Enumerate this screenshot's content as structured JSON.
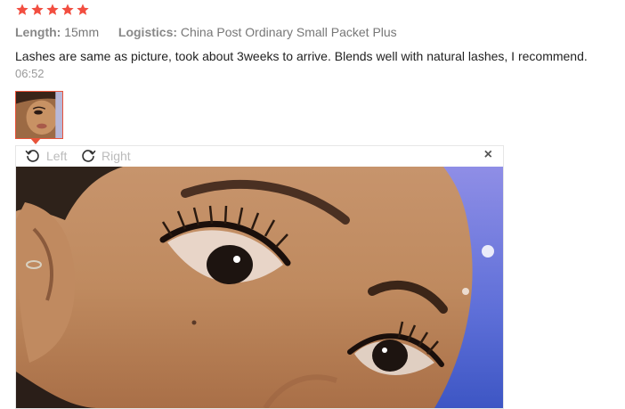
{
  "rating": {
    "stars": 5,
    "max": 5,
    "color": "#f24e40"
  },
  "meta": {
    "length_label": "Length:",
    "length_value": "15mm",
    "logistics_label": "Logistics:",
    "logistics_value": "China Post Ordinary Small Packet Plus"
  },
  "review": {
    "text": "Lashes are same as picture, took about 3weeks to arrive. Blends well with natural lashes, I recommend.",
    "time": "06:52"
  },
  "viewer": {
    "rotate_left_label": "Left",
    "rotate_right_label": "Right",
    "close_label": "×",
    "icons": {
      "rotate_left": "rotate-left-icon",
      "rotate_right": "rotate-right-icon",
      "close": "close-icon"
    }
  }
}
